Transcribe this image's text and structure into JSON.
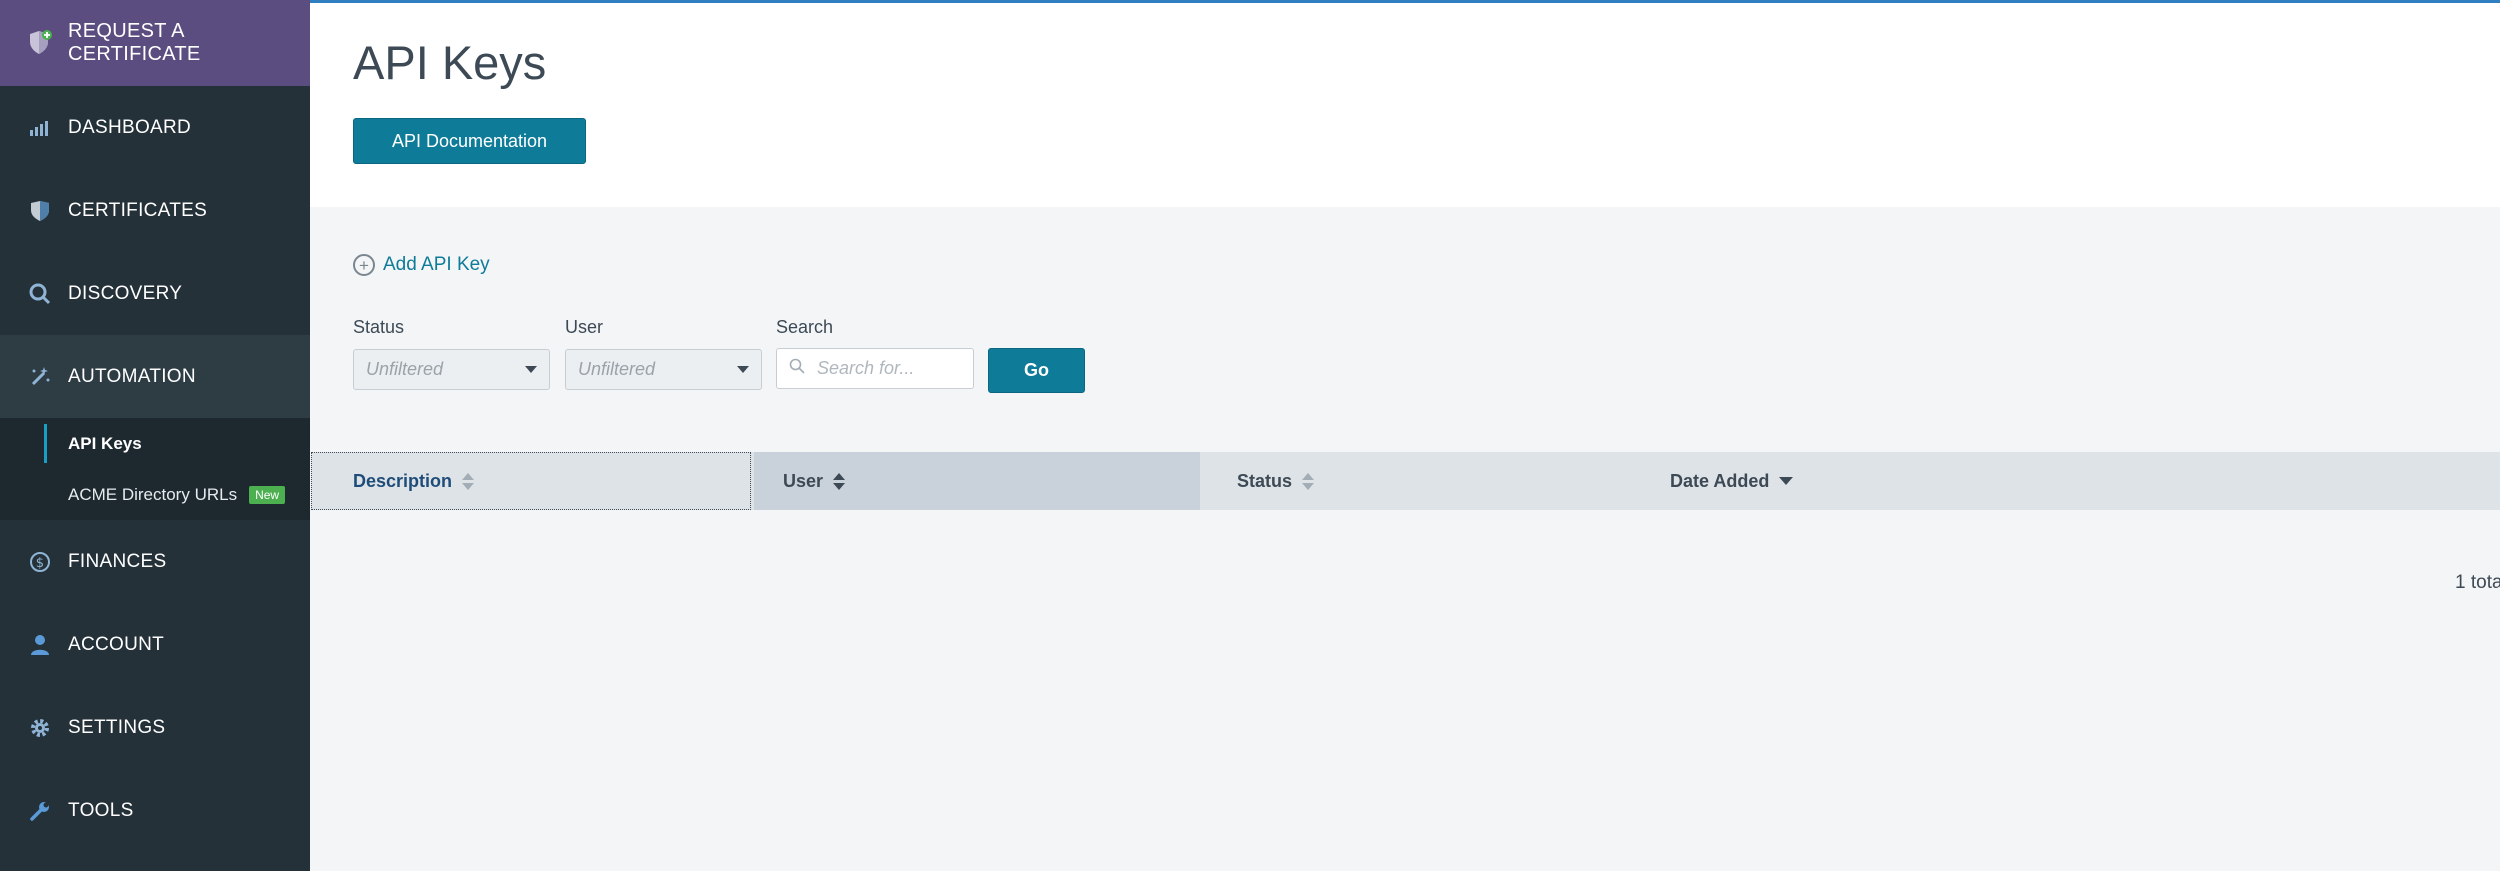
{
  "sidebar": {
    "request": "REQUEST A CERTIFICATE",
    "items": [
      {
        "label": "DASHBOARD",
        "icon": "bar-chart-icon"
      },
      {
        "label": "CERTIFICATES",
        "icon": "shield-icon"
      },
      {
        "label": "DISCOVERY",
        "icon": "magnifier-icon"
      },
      {
        "label": "AUTOMATION",
        "icon": "magic-wand-icon"
      },
      {
        "label": "FINANCES",
        "icon": "dollar-icon"
      },
      {
        "label": "ACCOUNT",
        "icon": "user-icon"
      },
      {
        "label": "SETTINGS",
        "icon": "gear-icon"
      },
      {
        "label": "TOOLS",
        "icon": "wrench-icon"
      }
    ],
    "sub_items": [
      {
        "label": "API Keys"
      },
      {
        "label": "ACME Directory URLs",
        "badge": "New"
      }
    ]
  },
  "page": {
    "title": "API Keys",
    "doc_button": "API Documentation",
    "add_key": "Add API Key"
  },
  "filters": {
    "status_label": "Status",
    "status_value": "Unfiltered",
    "user_label": "User",
    "user_value": "Unfiltered",
    "search_label": "Search",
    "search_placeholder": "Search for...",
    "go": "Go"
  },
  "table": {
    "columns": [
      "Description",
      "User",
      "Status",
      "Date Added"
    ]
  },
  "footer": {
    "total": "1 tota"
  },
  "colors": {
    "accent": "#0e7b98",
    "request_bg": "#5b4d80",
    "sidebar_bg": "#253139",
    "badge_green": "#4caf50"
  }
}
